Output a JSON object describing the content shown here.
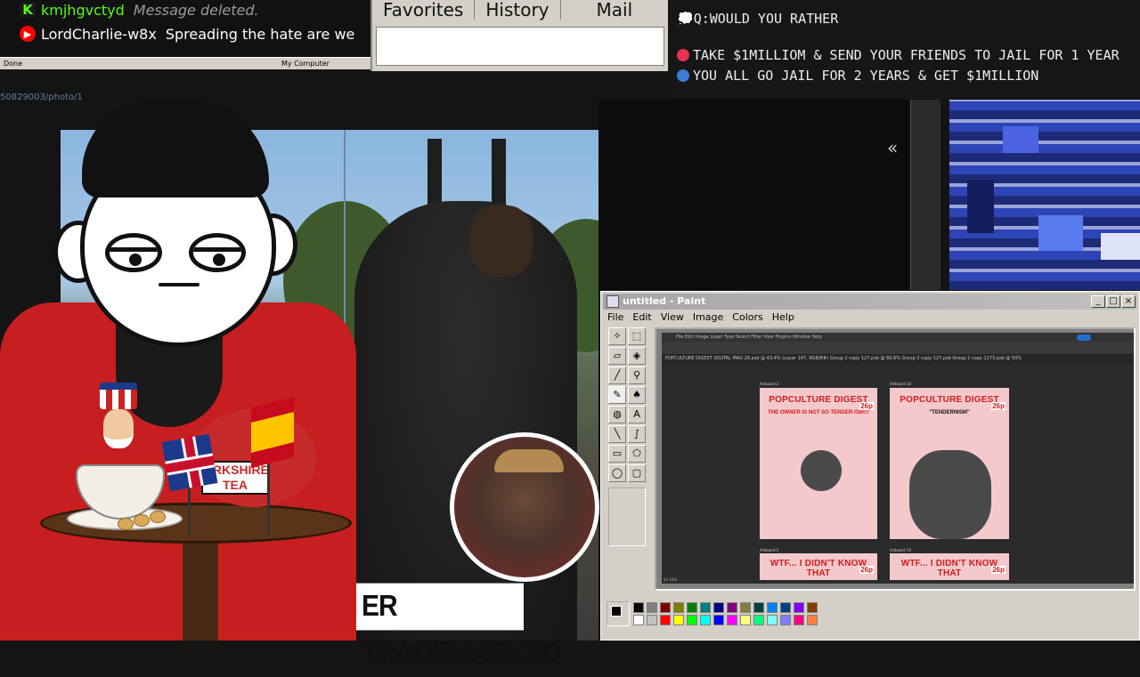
{
  "chat": {
    "messages": [
      {
        "platform_icon": "kick-icon",
        "user": "kmjhgvctyd",
        "text": "Message deleted.",
        "user_color": "#53fc18",
        "icon_color": "#53fc18",
        "text_color": "#9a9a9a"
      },
      {
        "platform_icon": "youtube-icon",
        "user": "LordCharlie-w8x",
        "text": "Spreading the hate are we",
        "user_color": "#ffffff",
        "icon_color": "#ff0000",
        "text_color": "#ffffff"
      }
    ],
    "statusbar": {
      "left": "Done",
      "right": "My Computer"
    }
  },
  "ie_menu": {
    "items": [
      "Favorites",
      "History",
      "Mail"
    ]
  },
  "question": {
    "text": "Q:WOULD YOU RATHER",
    "options": [
      {
        "text": "TAKE $1MILLIOM & SEND YOUR FRIENDS TO JAIL FOR 1 YEAR",
        "color": "#e8334f"
      },
      {
        "text": "YOU ALL GO JAIL FOR 2 YEARS & GET $1MILLION",
        "color": "#3a7bd5"
      }
    ]
  },
  "browser": {
    "url": "50829003/photo/1"
  },
  "photo": {
    "caption": "ER TRADEMARKED"
  },
  "teapot_label": "ORKSHIRE TEA",
  "paint": {
    "title": "untitled - Paint",
    "menu": [
      "File",
      "Edit",
      "View",
      "Image",
      "Colors",
      "Help"
    ],
    "photoshop": {
      "menu": "File  Edit  Image  Layer  Type  Select  Filter  View  Plugins  Window  Help",
      "tabs": "POPCULTURE DIGEST DIGITAL MAG 26.psd @ 43.4% (Layer 147, RGB/8#)   Group 2 copy 127.psb @ 66.6%   Group 2 copy 127.psb   Group 2 copy 1273.psb @ 50%",
      "status": "43.44%",
      "boards": [
        {
          "label": "Artboard 2",
          "title": "POPCULTURE DIGEST",
          "price": "26p",
          "headline": "THE OWNER IS NOT SO TENDER-ISM!!!"
        },
        {
          "label": "Artboard 18",
          "title": "POPCULTURE DIGEST",
          "price": "26p",
          "headline": "\"TENDERNISM\""
        },
        {
          "label": "Artboard 5",
          "title": "WTF... I DIDN'T KNOW THAT",
          "price": "26p",
          "headline": ""
        },
        {
          "label": "Artboard 19",
          "title": "WTF... I DIDN'T KNOW THAT",
          "price": "26p",
          "headline": ""
        }
      ]
    },
    "palette": [
      "#000000",
      "#808080",
      "#800000",
      "#808000",
      "#008000",
      "#008080",
      "#000080",
      "#800080",
      "#808040",
      "#004040",
      "#0080ff",
      "#004080",
      "#8000ff",
      "#804000",
      "#ffffff",
      "#c0c0c0",
      "#ff0000",
      "#ffff00",
      "#00ff00",
      "#00ffff",
      "#0000ff",
      "#ff00ff",
      "#ffff80",
      "#00ff80",
      "#80ffff",
      "#8080ff",
      "#ff0080",
      "#ff8040"
    ]
  },
  "theme": {
    "jacket": "#c71f1f",
    "pixel_block": "#2e45b8"
  }
}
